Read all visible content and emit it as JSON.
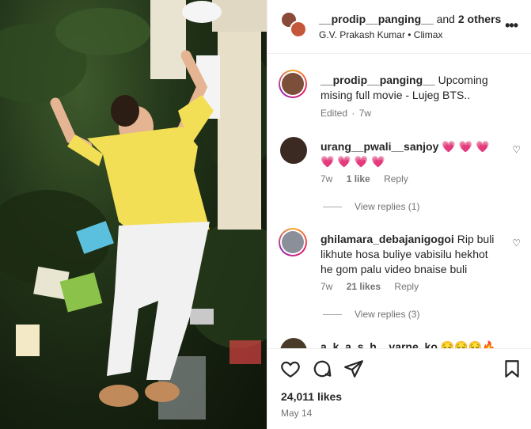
{
  "post_header": {
    "username": "__prodip__panging__",
    "collab_text": "and",
    "collab_others": "2 others",
    "audio": "G.V. Prakash Kumar • Climax",
    "more_icon": "more-horizontal-icon"
  },
  "caption": {
    "username": "__prodip__panging__",
    "text": "Upcoming mising full movie - Lujeg BTS..",
    "edited": "Edited",
    "separator": "·",
    "time": "7w"
  },
  "comments": [
    {
      "username": "urang__pwali__sanjoy",
      "text": "💗 💗 💗 💗 💗 💗 💗",
      "time": "7w",
      "likes": "1 like",
      "reply": "Reply",
      "view_replies": "View replies (1)"
    },
    {
      "username": "ghilamara_debajanigogoi",
      "text": "Rip buli likhute hosa buliye vabisilu hekhot he gom palu video bnaise buli",
      "time": "7w",
      "likes": "21 likes",
      "reply": "Reply",
      "view_replies": "View replies (3)"
    },
    {
      "username": "a_k_a_s_h__varne_ko",
      "text": "😔😔😔🔥"
    }
  ],
  "actions": {
    "likes_count": "24,011 likes",
    "date": "May 14"
  },
  "colors": {
    "story_ring": "#e91e63",
    "muted": "#737373"
  }
}
